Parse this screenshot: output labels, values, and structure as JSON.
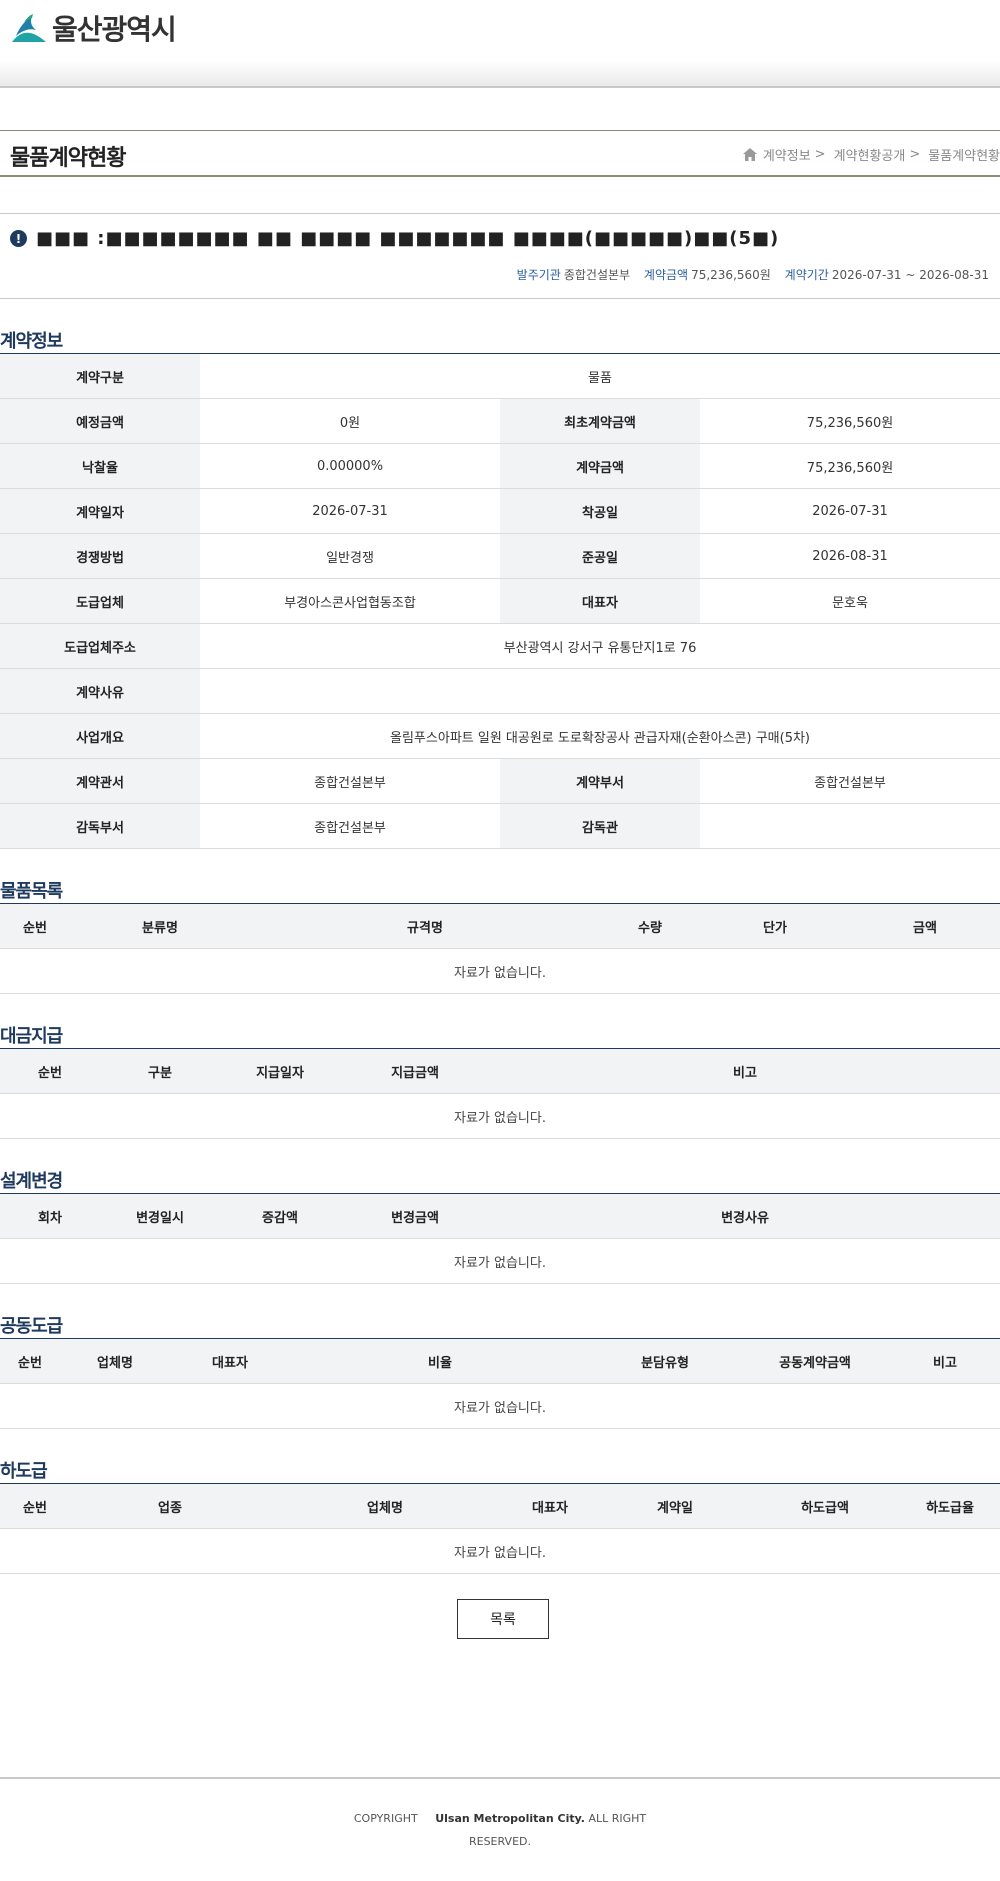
{
  "header": {
    "logo_text": "울산광역시"
  },
  "page": {
    "title": "물품계약현황",
    "breadcrumb": [
      "계약정보",
      "계약현황공개",
      "물품계약현황"
    ],
    "breadcrumb_sep": ">"
  },
  "notice": {
    "icon": "exclamation-circle-icon",
    "title": "■■■ :■■■■■■■■ ■■ ■■■■ ■■■■■■■ ■■■■(■■■■■)■■(5■)"
  },
  "summary": {
    "org_label": "발주기관",
    "org_value": "종합건설본부",
    "amount_label": "계약금액",
    "amount_value": "75,236,560원",
    "period_label": "계약기간",
    "period_value": "2026-07-31 ~ 2026-08-31"
  },
  "contract_info": {
    "title": "계약정보",
    "rows": [
      {
        "l1": "계약구분",
        "v1": "물품"
      },
      {
        "l1": "예정금액",
        "v1": "0원",
        "l2": "최초계약금액",
        "v2": "75,236,560원"
      },
      {
        "l1": "낙찰율",
        "v1": "0.00000%",
        "l2": "계약금액",
        "v2": "75,236,560원"
      },
      {
        "l1": "계약일자",
        "v1": "2026-07-31",
        "l2": "착공일",
        "v2": "2026-07-31"
      },
      {
        "l1": "경쟁방법",
        "v1": "일반경쟁",
        "l2": "준공일",
        "v2": "2026-08-31"
      },
      {
        "l1": "도급업체",
        "v1": "부경아스콘사업협동조합",
        "l2": "대표자",
        "v2": "문호욱"
      },
      {
        "l1": "도급업체주소",
        "v1": "부산광역시 강서구 유통단지1로 76"
      },
      {
        "l1": "계약사유",
        "v1": ""
      },
      {
        "l1": "사업개요",
        "v1": "올림푸스아파트 일원 대공원로 도로확장공사 관급자재(순환아스콘) 구매(5차)"
      },
      {
        "l1": "계약관서",
        "v1": "종합건설본부",
        "l2": "계약부서",
        "v2": "종합건설본부"
      },
      {
        "l1": "감독부서",
        "v1": "종합건설본부",
        "l2": "감독관",
        "v2": ""
      }
    ]
  },
  "goods": {
    "title": "물품목록",
    "columns": [
      "순번",
      "분류명",
      "규격명",
      "수량",
      "단가",
      "금액"
    ],
    "empty": "자료가 없습니다."
  },
  "payment": {
    "title": "대금지급",
    "columns": [
      "순번",
      "구분",
      "지급일자",
      "지급금액",
      "비고"
    ],
    "empty": "자료가 없습니다."
  },
  "design_change": {
    "title": "설계변경",
    "columns": [
      "회차",
      "변경일시",
      "증감액",
      "변경금액",
      "변경사유"
    ],
    "empty": "자료가 없습니다."
  },
  "joint": {
    "title": "공동도급",
    "columns": [
      "순번",
      "업체명",
      "대표자",
      "비율",
      "분담유형",
      "공동계약금액",
      "비고"
    ],
    "empty": "자료가 없습니다."
  },
  "subcontract": {
    "title": "하도급",
    "columns": [
      "순번",
      "업종",
      "업체명",
      "대표자",
      "계약일",
      "하도급액",
      "하도급율"
    ],
    "empty": "자료가 없습니다."
  },
  "buttons": {
    "list": "목록"
  },
  "footer": {
    "copyright_prefix": "COPYRIGHT",
    "copyright_name": "Ulsan Metropolitan City.",
    "copyright_suffix": "ALL RIGHT RESERVED."
  }
}
